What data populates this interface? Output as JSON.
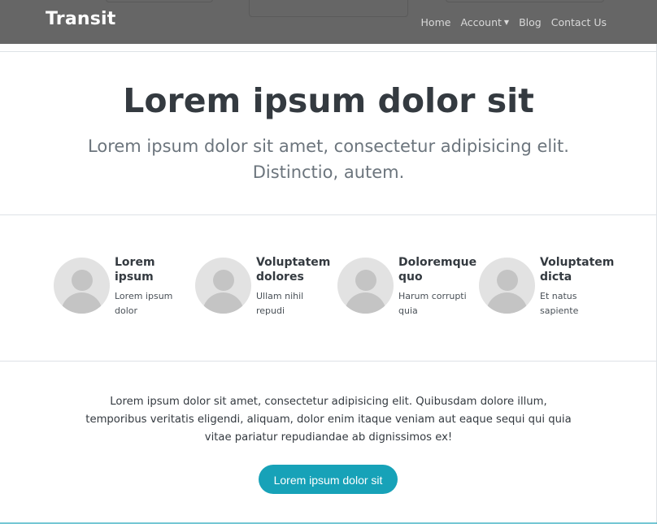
{
  "brand": "Transit",
  "nav": {
    "home": "Home",
    "account": "Account",
    "blog": "Blog",
    "contact": "Contact Us"
  },
  "hero": {
    "title": "Lorem ipsum dolor sit",
    "subtitle": "Lorem ipsum dolor sit amet, consectetur adipisicing elit. Distinctio, autem."
  },
  "features": [
    {
      "title": "Lorem ipsum",
      "text": "Lorem ipsum dolor"
    },
    {
      "title": "Voluptatem dolores",
      "text": "Ullam nihil repudi"
    },
    {
      "title": "Doloremque quo",
      "text": "Harum corrupti quia"
    },
    {
      "title": "Voluptatem dicta",
      "text": "Et natus sapiente"
    }
  ],
  "about": {
    "text": "Lorem ipsum dolor sit amet, consectetur adipisicing elit. Quibusdam dolore illum, temporibus veritatis eligendi, aliquam, dolor enim itaque veniam aut eaque sequi qui quia vitae pariatur repudiandae ab dignissimos ex!",
    "button": "Lorem ipsum dolor sit"
  },
  "colors": {
    "navbar": "#666666",
    "accent": "#17a2b8"
  }
}
